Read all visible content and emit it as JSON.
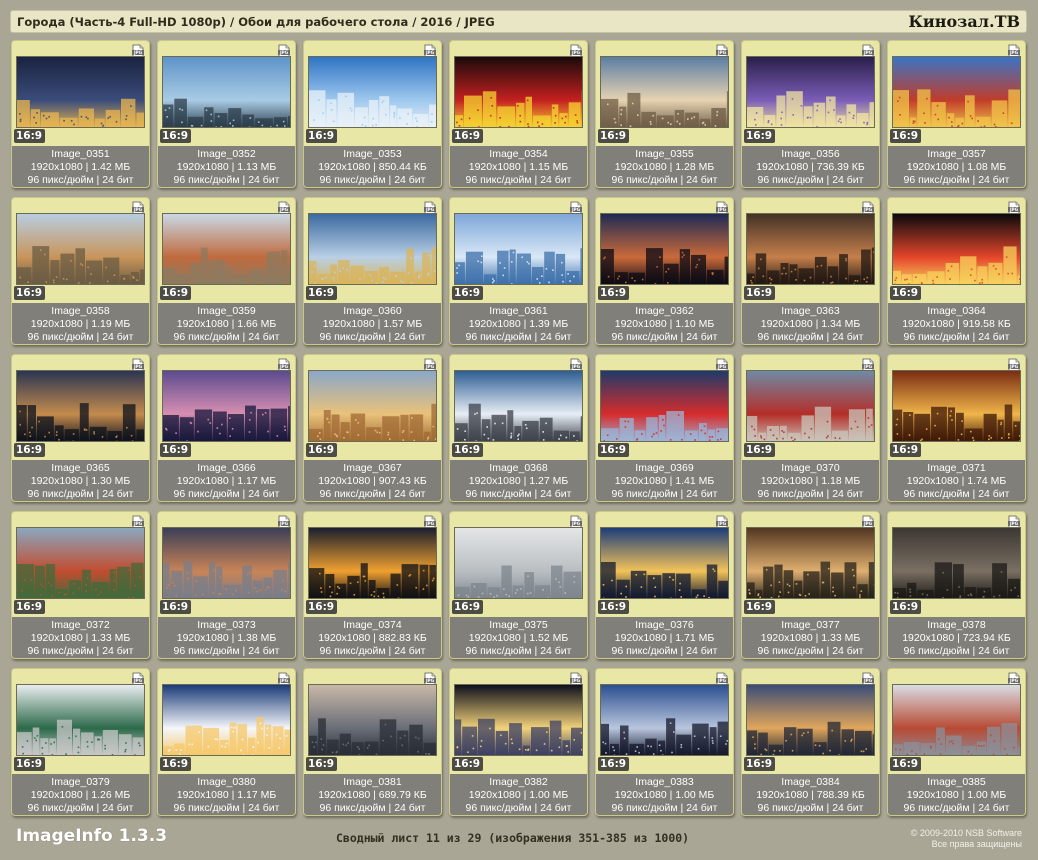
{
  "header": {
    "title": "Города (Часть-4 Full-HD 1080p) / Обои для рабочего стола / 2016 / JPEG",
    "brand": "Кинозал.ТВ"
  },
  "cards": [
    {
      "name": "Image_0351",
      "dims": "1920x1080 | 1.42 МБ",
      "dpi": "96 пикс/дюйм | 24 бит",
      "ratio": "16:9",
      "scene": "coast-night"
    },
    {
      "name": "Image_0352",
      "dims": "1920x1080 | 1.13 МБ",
      "dpi": "96 пикс/дюйм | 24 бит",
      "ratio": "16:9",
      "scene": "palms-skyline"
    },
    {
      "name": "Image_0353",
      "dims": "1920x1080 | 850.44 КБ",
      "dpi": "96 пикс/дюйм | 24 бит",
      "ratio": "16:9",
      "scene": "blue-tower"
    },
    {
      "name": "Image_0354",
      "dims": "1920x1080 | 1.15 МБ",
      "dpi": "96 пикс/дюйм | 24 бит",
      "ratio": "16:9",
      "scene": "neon-signs"
    },
    {
      "name": "Image_0355",
      "dims": "1920x1080 | 1.28 МБ",
      "dpi": "96 пикс/дюйм | 24 бит",
      "ratio": "16:9",
      "scene": "columns-tower"
    },
    {
      "name": "Image_0356",
      "dims": "1920x1080 | 736.39 КБ",
      "dpi": "96 пикс/дюйм | 24 бит",
      "ratio": "16:9",
      "scene": "xmas-tree"
    },
    {
      "name": "Image_0357",
      "dims": "1920x1080 | 1.08 МБ",
      "dpi": "96 пикс/дюйм | 24 бит",
      "ratio": "16:9",
      "scene": "cathedral-domes"
    },
    {
      "name": "Image_0358",
      "dims": "1920x1080 | 1.19 МБ",
      "dpi": "96 пикс/дюйм | 24 бит",
      "ratio": "16:9",
      "scene": "old-town-day"
    },
    {
      "name": "Image_0359",
      "dims": "1920x1080 | 1.66 МБ",
      "dpi": "96 пикс/дюйм | 24 бит",
      "ratio": "16:9",
      "scene": "roofs"
    },
    {
      "name": "Image_0360",
      "dims": "1920x1080 | 1.57 МБ",
      "dpi": "96 пикс/дюйм | 24 бит",
      "ratio": "16:9",
      "scene": "shard"
    },
    {
      "name": "Image_0361",
      "dims": "1920x1080 | 1.39 МБ",
      "dpi": "96 пикс/дюйм | 24 бит",
      "ratio": "16:9",
      "scene": "glass-building"
    },
    {
      "name": "Image_0362",
      "dims": "1920x1080 | 1.10 МБ",
      "dpi": "96 пикс/дюйм | 24 бит",
      "ratio": "16:9",
      "scene": "dusk-church"
    },
    {
      "name": "Image_0363",
      "dims": "1920x1080 | 1.34 МБ",
      "dpi": "96 пикс/дюйм | 24 бит",
      "ratio": "16:9",
      "scene": "canal-warehouse"
    },
    {
      "name": "Image_0364",
      "dims": "1920x1080 | 919.58 КБ",
      "dpi": "96 пикс/дюйм | 24 бит",
      "ratio": "16:9",
      "scene": "light-trails"
    },
    {
      "name": "Image_0365",
      "dims": "1920x1080 | 1.30 МБ",
      "dpi": "96 пикс/дюйм | 24 бит",
      "ratio": "16:9",
      "scene": "bay-night"
    },
    {
      "name": "Image_0366",
      "dims": "1920x1080 | 1.17 МБ",
      "dpi": "96 пикс/дюйм | 24 бит",
      "ratio": "16:9",
      "scene": "purple-coast"
    },
    {
      "name": "Image_0367",
      "dims": "1920x1080 | 907.43 КБ",
      "dpi": "96 пикс/дюйм | 24 бит",
      "ratio": "16:9",
      "scene": "big-ben"
    },
    {
      "name": "Image_0368",
      "dims": "1920x1080 | 1.27 МБ",
      "dpi": "96 пикс/дюйм | 24 бит",
      "ratio": "16:9",
      "scene": "aerial-city"
    },
    {
      "name": "Image_0369",
      "dims": "1920x1080 | 1.41 МБ",
      "dpi": "96 пикс/дюйм | 24 бит",
      "ratio": "16:9",
      "scene": "red-bridge"
    },
    {
      "name": "Image_0370",
      "dims": "1920x1080 | 1.18 МБ",
      "dpi": "96 пикс/дюйм | 24 бит",
      "ratio": "16:9",
      "scene": "ship"
    },
    {
      "name": "Image_0371",
      "dims": "1920x1080 | 1.74 МБ",
      "dpi": "96 пикс/дюйм | 24 бит",
      "ratio": "16:9",
      "scene": "golden-interior"
    },
    {
      "name": "Image_0372",
      "dims": "1920x1080 | 1.33 МБ",
      "dpi": "96 пикс/дюйм | 24 бит",
      "ratio": "16:9",
      "scene": "aerial-red-roofs"
    },
    {
      "name": "Image_0373",
      "dims": "1920x1080 | 1.38 МБ",
      "dpi": "96 пикс/дюйм | 24 бит",
      "ratio": "16:9",
      "scene": "wet-street"
    },
    {
      "name": "Image_0374",
      "dims": "1920x1080 | 882.83 КБ",
      "dpi": "96 пикс/дюйм | 24 бит",
      "ratio": "16:9",
      "scene": "bridge-night"
    },
    {
      "name": "Image_0375",
      "dims": "1920x1080 | 1.52 МБ",
      "dpi": "96 пикс/дюйм | 24 бит",
      "ratio": "16:9",
      "scene": "fog-city"
    },
    {
      "name": "Image_0376",
      "dims": "1920x1080 | 1.71 МБ",
      "dpi": "96 пикс/дюйм | 24 бит",
      "ratio": "16:9",
      "scene": "reflection-night"
    },
    {
      "name": "Image_0377",
      "dims": "1920x1080 | 1.33 МБ",
      "dpi": "96 пикс/дюйм | 24 бит",
      "ratio": "16:9",
      "scene": "square-aerial"
    },
    {
      "name": "Image_0378",
      "dims": "1920x1080 | 723.94 КБ",
      "dpi": "96 пикс/дюйм | 24 бит",
      "ratio": "16:9",
      "scene": "graffiti"
    },
    {
      "name": "Image_0379",
      "dims": "1920x1080 | 1.26 МБ",
      "dpi": "96 пикс/дюйм | 24 бит",
      "ratio": "16:9",
      "scene": "cannon"
    },
    {
      "name": "Image_0380",
      "dims": "1920x1080 | 1.17 МБ",
      "dpi": "96 пикс/дюйм | 24 бит",
      "ratio": "16:9",
      "scene": "snow-village"
    },
    {
      "name": "Image_0381",
      "dims": "1920x1080 | 689.79 КБ",
      "dpi": "96 пикс/дюйм | 24 бит",
      "ratio": "16:9",
      "scene": "manhattan"
    },
    {
      "name": "Image_0382",
      "dims": "1920x1080 | 1.00 МБ",
      "dpi": "96 пикс/дюйм | 24 бит",
      "ratio": "16:9",
      "scene": "lit-cathedral"
    },
    {
      "name": "Image_0383",
      "dims": "1920x1080 | 1.00 МБ",
      "dpi": "96 пикс/дюйм | 24 бит",
      "ratio": "16:9",
      "scene": "crown-building"
    },
    {
      "name": "Image_0384",
      "dims": "1920x1080 | 788.39 КБ",
      "dpi": "96 пикс/дюйм | 24 бит",
      "ratio": "16:9",
      "scene": "river-aerial"
    },
    {
      "name": "Image_0385",
      "dims": "1920x1080 | 1.00 МБ",
      "dpi": "96 пикс/дюйм | 24 бит",
      "ratio": "16:9",
      "scene": "snow-street"
    }
  ],
  "footer": {
    "app_name": "ImageInfo 1.3.3",
    "sheet_info": "Сводный лист 11 из 29 (изображения 351-385 из 1000)",
    "copyright_line1": "© 2009-2010 NSB Software",
    "copyright_line2": "Все права защищены"
  },
  "icons": {
    "file_type": "jpg-file-icon"
  },
  "colors": {
    "background": "#a9a695",
    "card": "#e9e7a5",
    "info_panel": "#807f79",
    "header_bar": "#e8e6c4"
  }
}
